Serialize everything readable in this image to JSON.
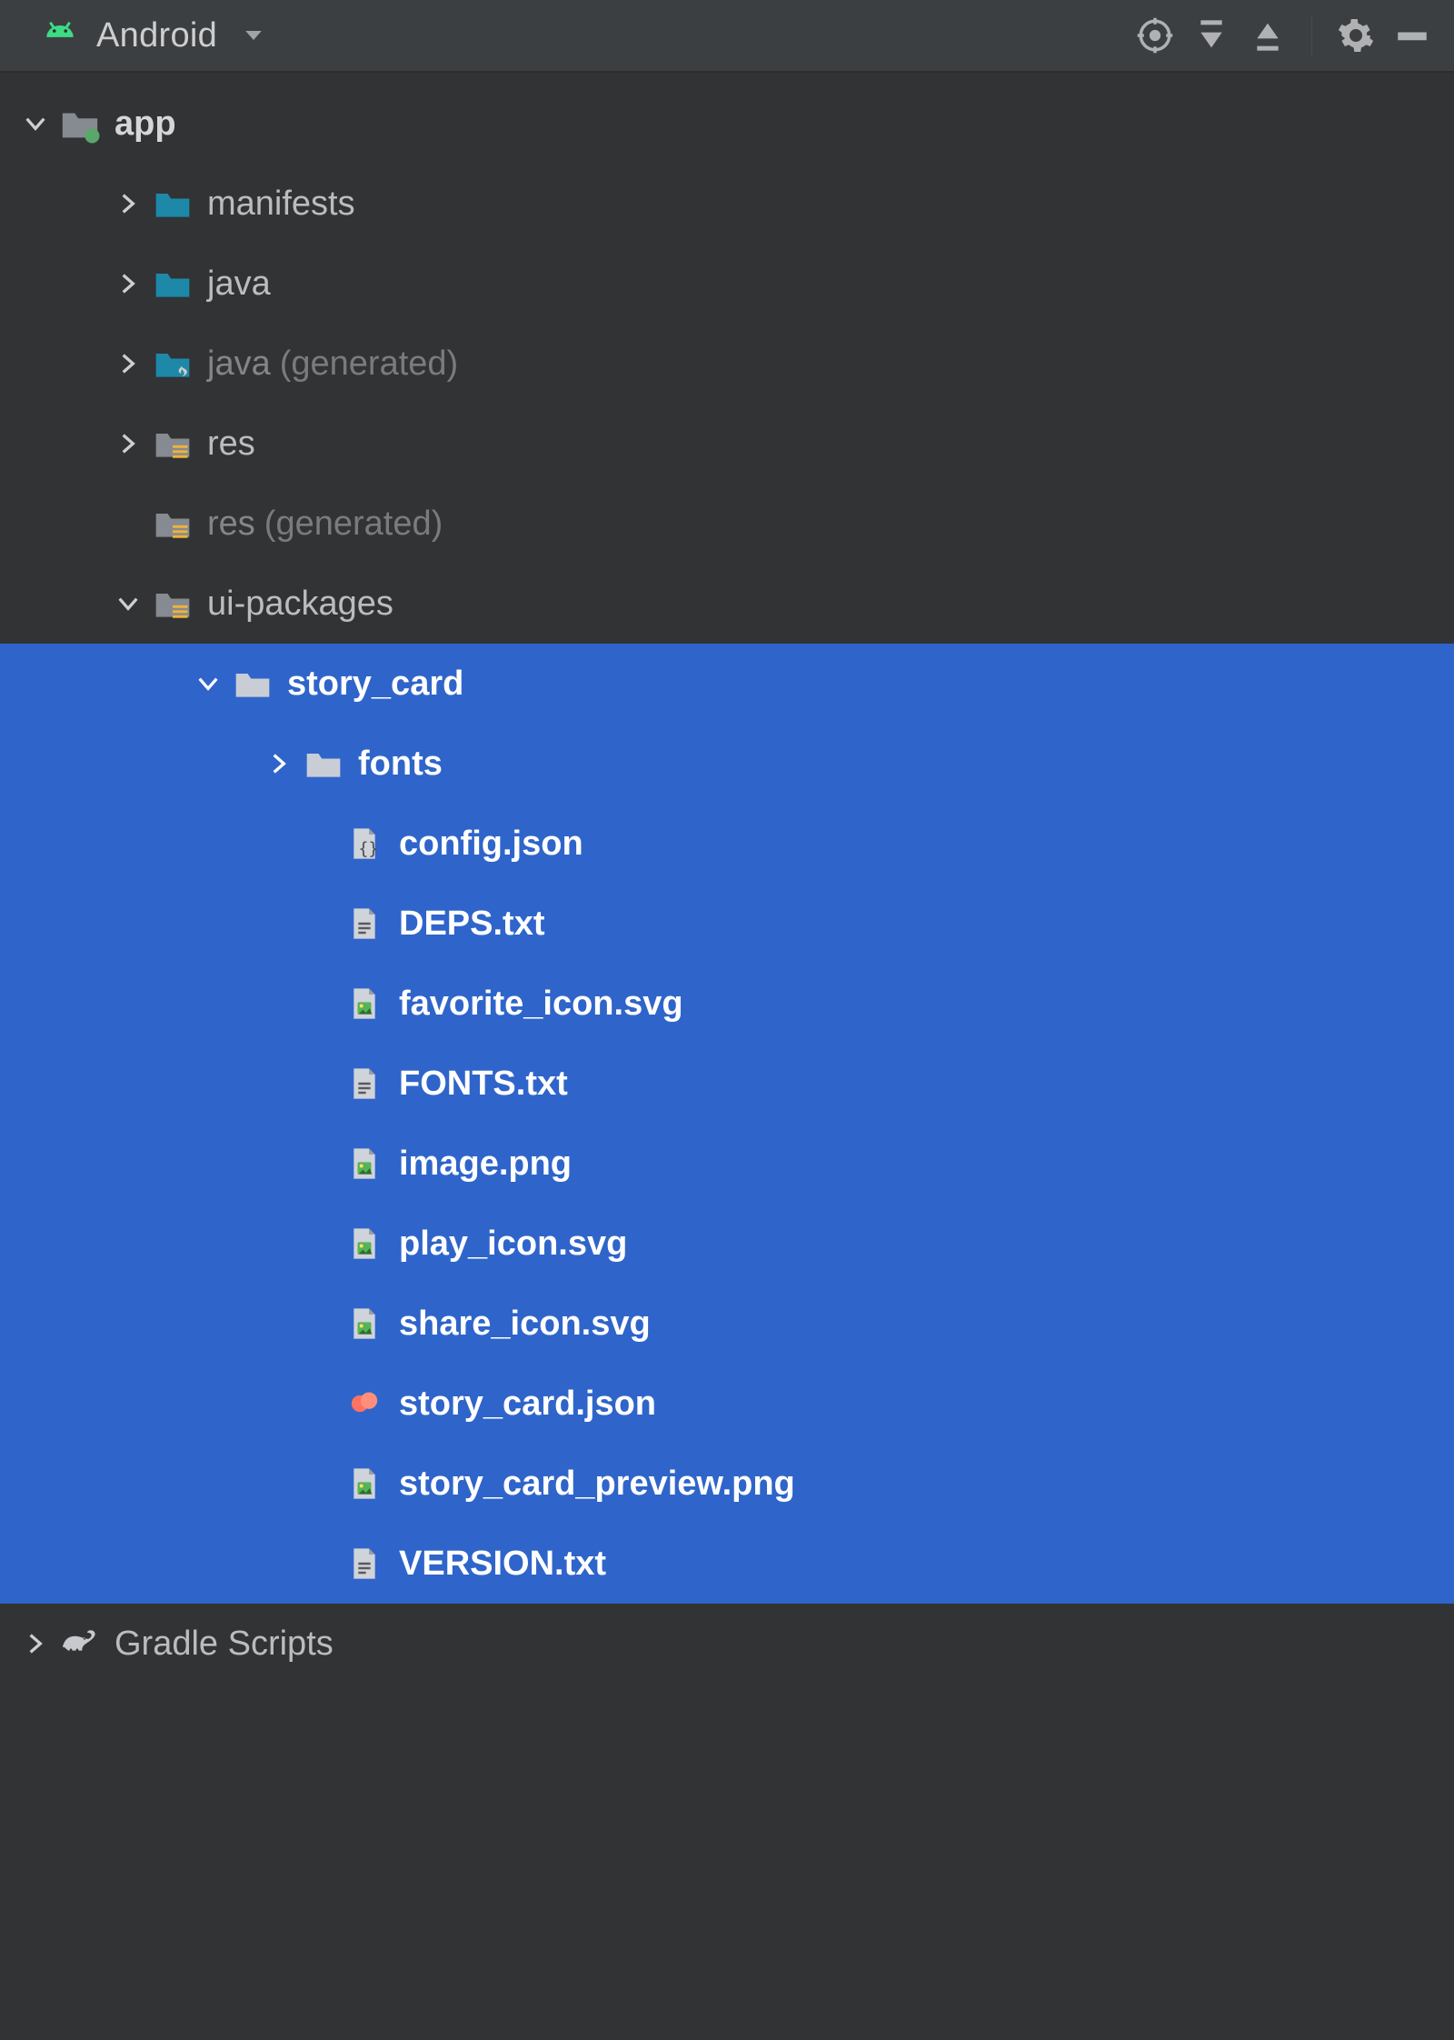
{
  "toolbar": {
    "view_label": "Android"
  },
  "tree": {
    "app": "app",
    "manifests": "manifests",
    "java": "java",
    "java_gen": "java",
    "generated": "(generated)",
    "res": "res",
    "res_gen": "res",
    "ui_packages": "ui-packages",
    "story_card": "story_card",
    "fonts": "fonts",
    "config_json": "config.json",
    "deps_txt": "DEPS.txt",
    "favorite_icon_svg": "favorite_icon.svg",
    "fonts_txt": "FONTS.txt",
    "image_png": "image.png",
    "play_icon_svg": "play_icon.svg",
    "share_icon_svg": "share_icon.svg",
    "story_card_json": "story_card.json",
    "story_card_preview_png": "story_card_preview.png",
    "version_txt": "VERSION.txt",
    "gradle_scripts": "Gradle Scripts"
  }
}
